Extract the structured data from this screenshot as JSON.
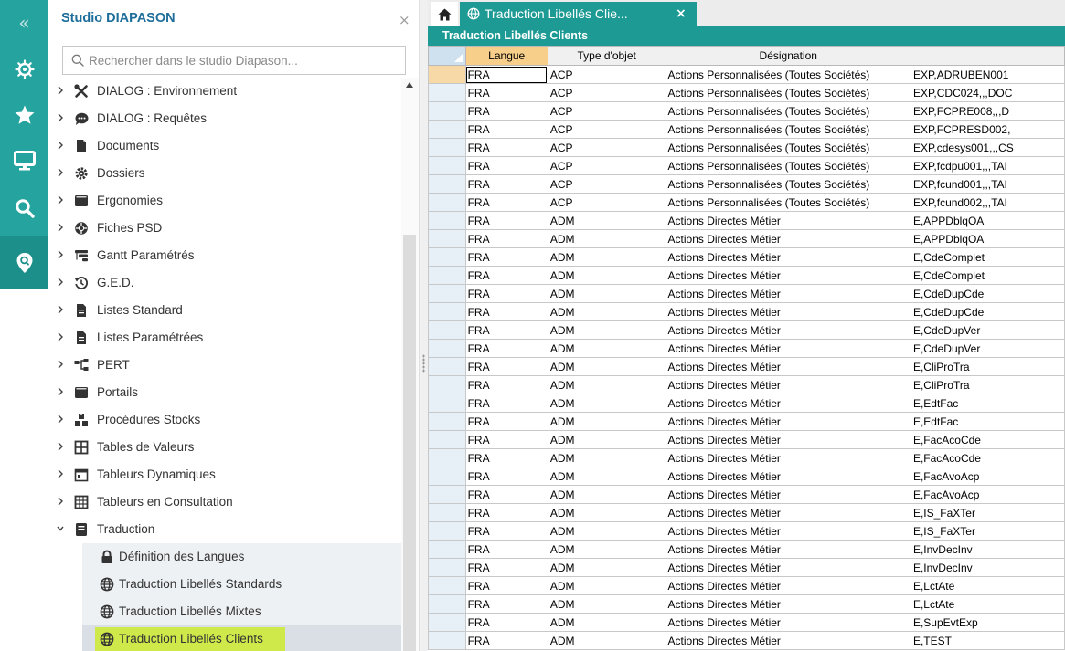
{
  "rail": {
    "collapse_glyph": "«",
    "items": [
      {
        "icon": "helm-icon"
      },
      {
        "icon": "star-icon"
      },
      {
        "icon": "monitor-icon"
      },
      {
        "icon": "search-icon"
      },
      {
        "icon": "location-search-icon",
        "active": true
      }
    ]
  },
  "studio": {
    "title": "Studio DIAPASON",
    "close_glyph": "×",
    "search_placeholder": "Rechercher dans le studio Diapason...",
    "tree": [
      {
        "label": "DIALOG : Environnement",
        "icon": "tools-icon"
      },
      {
        "label": "DIALOG : Requêtes",
        "icon": "chat-icon"
      },
      {
        "label": "Documents",
        "icon": "document-icon"
      },
      {
        "label": "Dossiers",
        "icon": "gear-folder-icon"
      },
      {
        "label": "Ergonomies",
        "icon": "window-icon"
      },
      {
        "label": "Fiches PSD",
        "icon": "badge-icon"
      },
      {
        "label": "Gantt Paramétrés",
        "icon": "gantt-icon"
      },
      {
        "label": "G.E.D.",
        "icon": "history-icon"
      },
      {
        "label": "Listes Standard",
        "icon": "list-doc-icon"
      },
      {
        "label": "Listes Paramétrées",
        "icon": "list-doc-icon"
      },
      {
        "label": "PERT",
        "icon": "network-icon"
      },
      {
        "label": "Portails",
        "icon": "window-icon"
      },
      {
        "label": "Procédures Stocks",
        "icon": "boxes-icon"
      },
      {
        "label": "Tables de Valeurs",
        "icon": "table-icon"
      },
      {
        "label": "Tableurs Dynamiques",
        "icon": "calendar-icon"
      },
      {
        "label": "Tableurs en Consultation",
        "icon": "grid-icon"
      },
      {
        "label": "Traduction",
        "icon": "book-icon",
        "expanded": true
      }
    ],
    "children": [
      {
        "label": "Définition des Langues",
        "icon": "lock-icon"
      },
      {
        "label": "Traduction Libellés Standards",
        "icon": "globe-icon"
      },
      {
        "label": "Traduction Libellés Mixtes",
        "icon": "globe-icon"
      },
      {
        "label": "Traduction Libellés Clients",
        "icon": "globe-icon",
        "selected": true
      }
    ]
  },
  "tabs": {
    "home_icon": "home-icon",
    "active_label": "Traduction Libellés Clie...",
    "close_glyph": "×"
  },
  "grid": {
    "title": "Traduction Libellés Clients",
    "columns": [
      "Langue",
      "Type d'objet",
      "Désignation",
      ""
    ],
    "rows": [
      [
        "FRA",
        "ACP",
        "Actions Personnalisées (Toutes Sociétés)",
        "EXP,ADRUBEN001"
      ],
      [
        "FRA",
        "ACP",
        "Actions Personnalisées (Toutes Sociétés)",
        "EXP,CDC024,,,DOC"
      ],
      [
        "FRA",
        "ACP",
        "Actions Personnalisées (Toutes Sociétés)",
        "EXP,FCPRE008,,,D"
      ],
      [
        "FRA",
        "ACP",
        "Actions Personnalisées (Toutes Sociétés)",
        "EXP,FCPRESD002,"
      ],
      [
        "FRA",
        "ACP",
        "Actions Personnalisées (Toutes Sociétés)",
        "EXP,cdesys001,,,CS"
      ],
      [
        "FRA",
        "ACP",
        "Actions Personnalisées (Toutes Sociétés)",
        "EXP,fcdpu001,,,TAI"
      ],
      [
        "FRA",
        "ACP",
        "Actions Personnalisées (Toutes Sociétés)",
        "EXP,fcund001,,,TAI"
      ],
      [
        "FRA",
        "ACP",
        "Actions Personnalisées (Toutes Sociétés)",
        "EXP,fcund002,,,TAI"
      ],
      [
        "FRA",
        "ADM",
        "Actions Directes Métier",
        "E,APPDblqOA"
      ],
      [
        "FRA",
        "ADM",
        "Actions Directes Métier",
        "E,APPDblqOA"
      ],
      [
        "FRA",
        "ADM",
        "Actions Directes Métier",
        "E,CdeComplet"
      ],
      [
        "FRA",
        "ADM",
        "Actions Directes Métier",
        "E,CdeComplet"
      ],
      [
        "FRA",
        "ADM",
        "Actions Directes Métier",
        "E,CdeDupCde"
      ],
      [
        "FRA",
        "ADM",
        "Actions Directes Métier",
        "E,CdeDupCde"
      ],
      [
        "FRA",
        "ADM",
        "Actions Directes Métier",
        "E,CdeDupVer"
      ],
      [
        "FRA",
        "ADM",
        "Actions Directes Métier",
        "E,CdeDupVer"
      ],
      [
        "FRA",
        "ADM",
        "Actions Directes Métier",
        "E,CliProTra"
      ],
      [
        "FRA",
        "ADM",
        "Actions Directes Métier",
        "E,CliProTra"
      ],
      [
        "FRA",
        "ADM",
        "Actions Directes Métier",
        "E,EdtFac"
      ],
      [
        "FRA",
        "ADM",
        "Actions Directes Métier",
        "E,EdtFac"
      ],
      [
        "FRA",
        "ADM",
        "Actions Directes Métier",
        "E,FacAcoCde"
      ],
      [
        "FRA",
        "ADM",
        "Actions Directes Métier",
        "E,FacAcoCde"
      ],
      [
        "FRA",
        "ADM",
        "Actions Directes Métier",
        "E,FacAvoAcp"
      ],
      [
        "FRA",
        "ADM",
        "Actions Directes Métier",
        "E,FacAvoAcp"
      ],
      [
        "FRA",
        "ADM",
        "Actions Directes Métier",
        "E,IS_FaXTer"
      ],
      [
        "FRA",
        "ADM",
        "Actions Directes Métier",
        "E,IS_FaXTer"
      ],
      [
        "FRA",
        "ADM",
        "Actions Directes Métier",
        "E,InvDecInv"
      ],
      [
        "FRA",
        "ADM",
        "Actions Directes Métier",
        "E,InvDecInv"
      ],
      [
        "FRA",
        "ADM",
        "Actions Directes Métier",
        "E,LctAte"
      ],
      [
        "FRA",
        "ADM",
        "Actions Directes Métier",
        "E,LctAte"
      ],
      [
        "FRA",
        "ADM",
        "Actions Directes Métier",
        "E,SupEvtExp"
      ],
      [
        "FRA",
        "ADM",
        "Actions Directes Métier",
        "E,TEST"
      ]
    ]
  },
  "colors": {
    "rail": "#25a39e",
    "tab_active": "#1e9a95",
    "title_link": "#1d6e9a",
    "selection_highlight": "#cfe84a",
    "sorted_header": "#f7cf8a"
  }
}
